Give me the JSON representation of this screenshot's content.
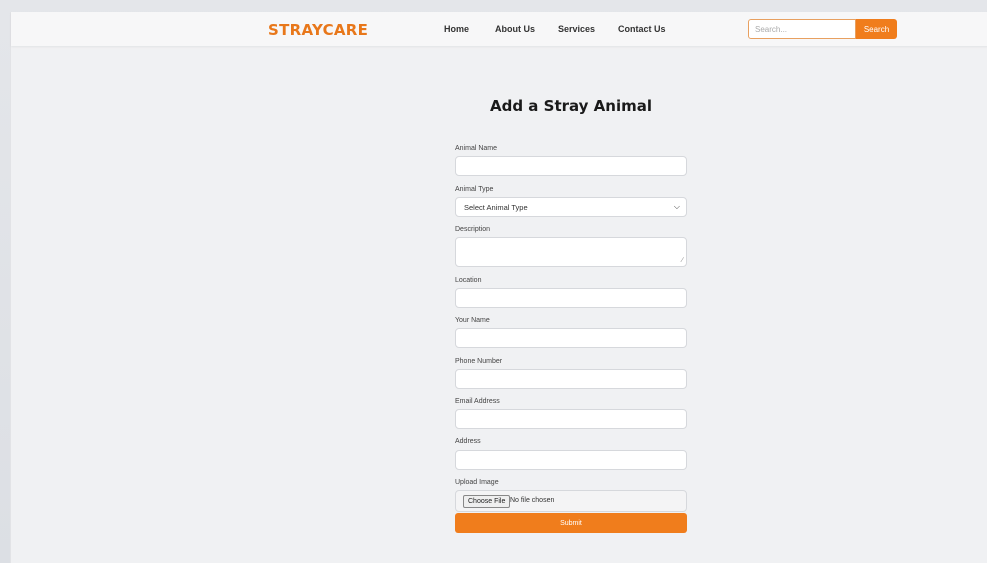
{
  "header": {
    "logo": "STRAYCARE",
    "nav": [
      {
        "label": "Home"
      },
      {
        "label": "About Us"
      },
      {
        "label": "Services"
      },
      {
        "label": "Contact Us"
      }
    ],
    "search_placeholder": "Search...",
    "search_button": "Search"
  },
  "form": {
    "title": "Add a Stray Animal",
    "animal_name_label": "Animal Name",
    "animal_type_label": "Animal Type",
    "animal_type_selected": "Select Animal Type",
    "description_label": "Description",
    "location_label": "Location",
    "your_name_label": "Your Name",
    "phone_label": "Phone Number",
    "email_label": "Email Address",
    "address_label": "Address",
    "upload_label": "Upload Image",
    "choose_file_button": "Choose File",
    "file_status": "No file chosen",
    "submit_button": "Submit"
  },
  "colors": {
    "accent": "#f07d1c",
    "logo": "#e8771a"
  },
  "icons": {
    "select": "chevron-down-icon",
    "textarea": "resize-grip-icon"
  }
}
